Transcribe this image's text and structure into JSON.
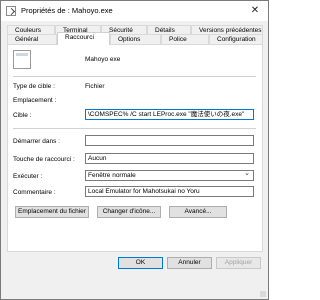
{
  "window": {
    "title": "Propriétés de : Mahoyo.exe",
    "close_glyph": "✕"
  },
  "tabs": {
    "row1": [
      "Couleurs",
      "Terminal",
      "Sécurité",
      "Détails",
      "Versions précédentes"
    ],
    "row2": [
      "Général",
      "Raccourci",
      "Options",
      "Police",
      "Configuration"
    ],
    "active": "Raccourci"
  },
  "shortcut": {
    "name": "Mahoyo exe",
    "type_label": "Type de cible :",
    "type_value": "Fichier",
    "location_label": "Emplacement :",
    "location_value": "",
    "target_label": "Cible :",
    "target_value": "\\COMSPEC% /C start LEProc.exe \"魔法使いの夜.exe\"",
    "start_in_label": "Démarrer dans :",
    "start_in_value": "",
    "hotkey_label": "Touche de raccourci :",
    "hotkey_value": "Aucun",
    "run_label": "Exécuter :",
    "run_value": "Fenêtre normale",
    "comment_label": "Commentaire :",
    "comment_value": "Local Emulator for Mahotsukai no Yoru"
  },
  "action_buttons": {
    "file_location": "Emplacement du fichier",
    "change_icon": "Changer d'icône...",
    "advanced": "Avancé..."
  },
  "footer": {
    "ok": "OK",
    "cancel": "Annuler",
    "apply": "Appliquer"
  },
  "icons": {
    "title": "shortcut-file-icon",
    "app": "app-file-icon",
    "close": "close-icon"
  }
}
